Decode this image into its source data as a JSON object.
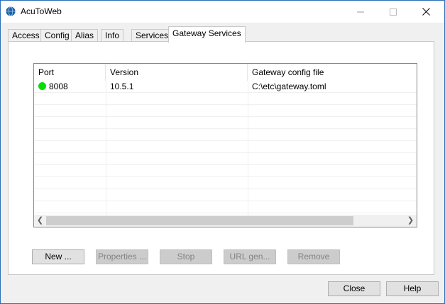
{
  "window": {
    "title": "AcuToWeb"
  },
  "tabs": [
    {
      "label": "Access"
    },
    {
      "label": "Config"
    },
    {
      "label": "Alias"
    },
    {
      "label": "Info"
    },
    {
      "label": "Services"
    },
    {
      "label": "Gateway Services",
      "active": true
    }
  ],
  "listview": {
    "columns": [
      "Port",
      "Version",
      "Gateway config file"
    ],
    "rows": [
      {
        "port": "8008",
        "version": "10.5.1",
        "config_file": "C:\\etc\\gateway.toml",
        "status_color": "#00e000"
      }
    ]
  },
  "action_buttons": [
    {
      "label": "New ...",
      "enabled": true
    },
    {
      "label": "Properties ...",
      "enabled": false
    },
    {
      "label": "Stop",
      "enabled": false
    },
    {
      "label": "URL gen...",
      "enabled": false
    },
    {
      "label": "Remove",
      "enabled": false
    }
  ],
  "footer_buttons": {
    "close": "Close",
    "help": "Help"
  },
  "colors": {
    "accent_border": "#2b6fb6",
    "status_running": "#00e000"
  }
}
